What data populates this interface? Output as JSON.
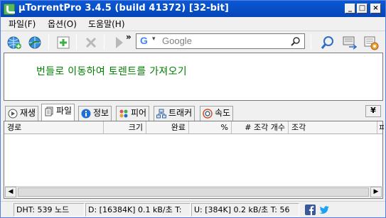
{
  "window": {
    "title": "µTorrentPro 3.4.5  (build 41372) [32-bit]",
    "controls": {
      "minimize": "_",
      "maximize": "□",
      "close": "×"
    }
  },
  "menu": {
    "items": [
      {
        "label": "파일(F)"
      },
      {
        "label": "옵션(O)"
      },
      {
        "label": "도움말(H)"
      }
    ]
  },
  "toolbar": {
    "overflow": "»",
    "search": {
      "provider_letter": "G",
      "arrow": "▾",
      "placeholder": "Google"
    }
  },
  "content": {
    "message": "번들로 이동하여 토렌트를 가져오기"
  },
  "tabs": {
    "items": [
      {
        "label": "재생"
      },
      {
        "label": "파일",
        "active": true
      },
      {
        "label": "정보"
      },
      {
        "label": "피어"
      },
      {
        "label": "트래커"
      },
      {
        "label": "속도"
      }
    ],
    "collapse": "¥"
  },
  "files_table": {
    "columns": [
      "경로",
      "크기",
      "완료",
      "%",
      "# 조각 개수",
      "조각",
      "ㅍ"
    ],
    "rows": []
  },
  "statusbar": {
    "dht": "DHT: 539 노드",
    "download": "D: [16384K] 0.1 kB/초 T:",
    "upload": "U: [384K] 0.2 kB/초 T: 56",
    "social": [
      "facebook-icon",
      "twitter-icon"
    ]
  },
  "colors": {
    "title_bar": "#0a58d6",
    "notice_text": "#008000",
    "facebook": "#3b5998",
    "twitter": "#1da1f2"
  }
}
